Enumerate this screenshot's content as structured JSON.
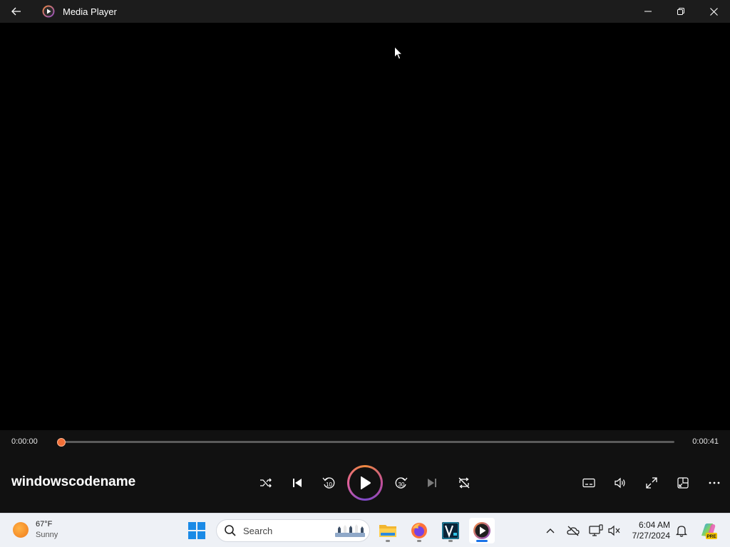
{
  "window": {
    "title": "Media Player",
    "icons": {
      "back": "back-arrow-icon",
      "app": "media-player-app-icon"
    },
    "controls": [
      "minimize-icon",
      "restore-icon",
      "close-icon"
    ]
  },
  "player": {
    "current_time": "0:00:00",
    "duration": "0:00:41",
    "progress_fraction": 0,
    "track_title": "windowscodename",
    "buttons": [
      "shuffle",
      "previous",
      "rewind-10",
      "play",
      "forward-30",
      "next",
      "repeat",
      "captions",
      "volume",
      "fullscreen",
      "mini-player",
      "more"
    ],
    "rewind_label": "10",
    "forward_label": "30",
    "accent_color": "#f26f37"
  },
  "taskbar": {
    "weather": {
      "temp": "67°F",
      "condition": "Sunny"
    },
    "search": {
      "placeholder": "Search"
    },
    "apps": [
      "file-explorer",
      "firefox",
      "vegas",
      "media-player"
    ],
    "tray": [
      "show-hidden-icons",
      "onedrive",
      "network",
      "volume"
    ],
    "clock": {
      "time": "6:04 AM",
      "date": "7/27/2024"
    },
    "copilot_badge": "PRE"
  }
}
